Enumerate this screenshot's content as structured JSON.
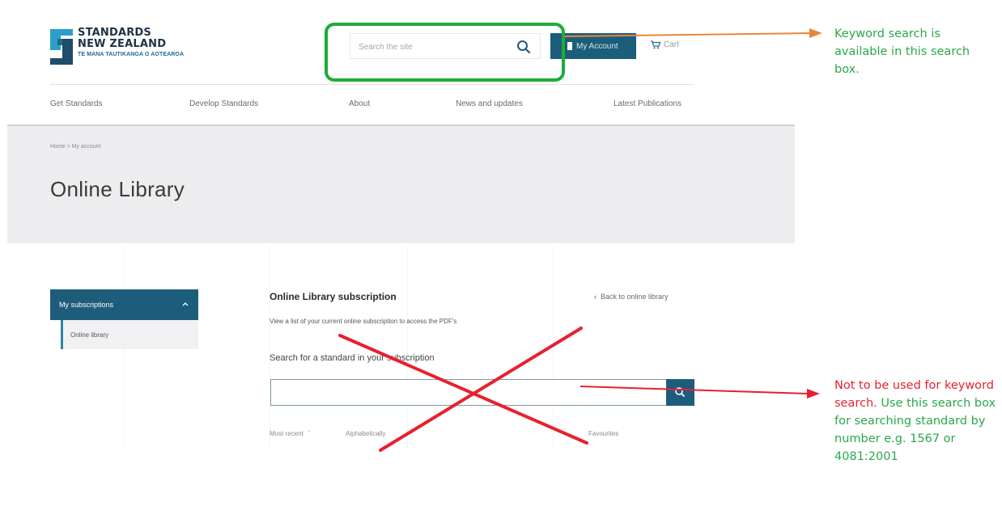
{
  "logo": {
    "line1": "STANDARDS",
    "line2": "NEW ZEALAND",
    "line3": "TE MANA TAUTIKANGA O AOTEAROA"
  },
  "header": {
    "search_placeholder": "Search the site",
    "account_label": "My Account",
    "cart_label": "Cart"
  },
  "nav": {
    "items": [
      "Get Standards",
      "Develop Standards",
      "About",
      "News and updates",
      "Latest Publications"
    ]
  },
  "page": {
    "breadcrumb": "Home  >  My account",
    "title": "Online Library"
  },
  "sidebar": {
    "section_label": "My subscriptions",
    "active_item": "Online library"
  },
  "main": {
    "subtitle": "Online Library subscription",
    "back_link": "Back to online library",
    "description": "View a list of your current online subscription to access the PDF's",
    "search_label": "Search for a standard in your subscription",
    "sort_options": [
      "Most recent",
      "Alphabetically",
      "Favourites"
    ]
  },
  "annotations": {
    "note_top": "Keyword search is available in this search box.",
    "note_bottom_red": "Not to be used for keyword search.",
    "note_bottom_green": "Use this search box for searching standard by number e.g. 1567 or 4081:2001"
  },
  "colors": {
    "brand_teal": "#1d5d7b",
    "highlight_green": "#1cac3a",
    "annotation_orange": "#e8863a",
    "annotation_red": "#e8202d",
    "annotation_green": "#2aa84a"
  }
}
